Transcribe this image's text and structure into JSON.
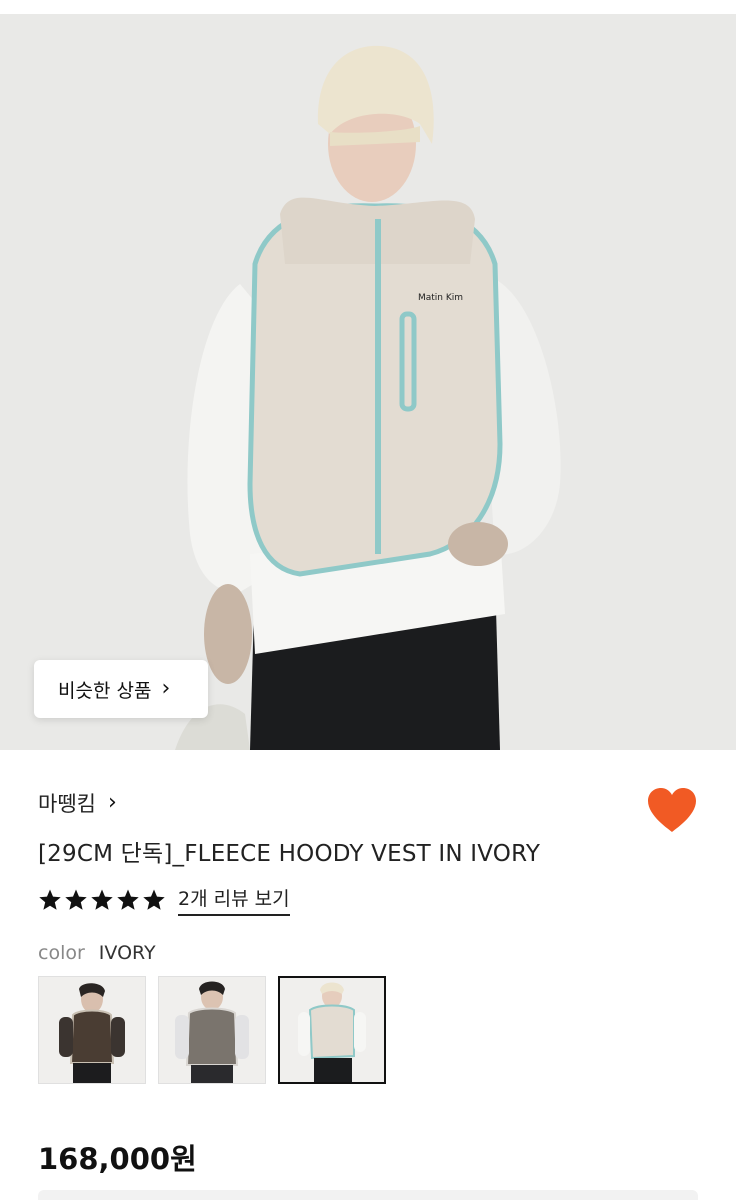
{
  "similar_button": {
    "label": "비슷한 상품",
    "icon": "chevron-right-icon"
  },
  "product": {
    "brand": "마뗑킴",
    "title": "[29CM 단독]_FLEECE HOODY VEST IN IVORY",
    "rating_stars": 5,
    "review_link": "2개 리뷰 보기",
    "color_label": "color",
    "color_value": "IVORY",
    "price": "168,000원",
    "brand_logo_text": "Matin Kim"
  },
  "colors": {
    "heart": "#f15a24",
    "star": "#111111",
    "vest_ivory": "#e3dcd2",
    "trim_mint": "#8fc9c8",
    "vest_brown": "#4a3d33",
    "vest_gray": "#7a746d"
  },
  "swatches": [
    {
      "name": "brown",
      "selected": false
    },
    {
      "name": "gray",
      "selected": false
    },
    {
      "name": "ivory",
      "selected": true
    }
  ]
}
